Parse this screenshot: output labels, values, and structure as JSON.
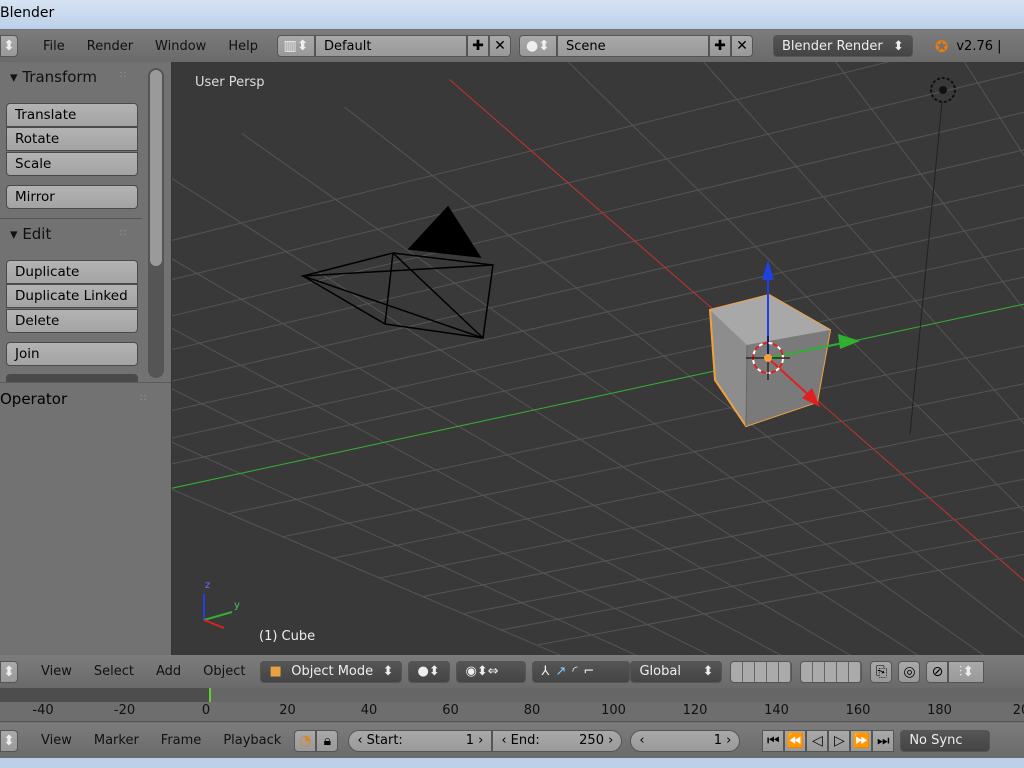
{
  "window": {
    "title": "Blender"
  },
  "topbar": {
    "menus": [
      "File",
      "Render",
      "Window",
      "Help"
    ],
    "screen_layout": "Default",
    "scene": "Scene",
    "render_engine": "Blender Render",
    "version": "v2.76 |"
  },
  "toolshelf": {
    "transform": {
      "title": "Transform",
      "buttons": [
        "Translate",
        "Rotate",
        "Scale",
        "Mirror"
      ]
    },
    "edit": {
      "title": "Edit",
      "buttons": [
        "Duplicate",
        "Duplicate Linked",
        "Delete",
        "Join"
      ]
    },
    "operator_title": "Operator"
  },
  "viewport": {
    "view_label": "User Persp",
    "object_label": "(1) Cube",
    "axis_labels": {
      "z": "z",
      "y": "y"
    }
  },
  "view3d_header": {
    "menus": [
      "View",
      "Select",
      "Add",
      "Object"
    ],
    "mode": "Object Mode",
    "orientation": "Global"
  },
  "timeline": {
    "ticks": [
      "-40",
      "-20",
      "0",
      "20",
      "40",
      "60",
      "80",
      "100",
      "120",
      "140",
      "160",
      "180",
      "20"
    ],
    "current_frame_marker": 0
  },
  "timeline_header": {
    "menus": [
      "View",
      "Marker",
      "Frame",
      "Playback"
    ],
    "start_label": "Start:",
    "start": "1",
    "end_label": "End:",
    "end": "250",
    "current": "1",
    "sync": "No Sync"
  },
  "colors": {
    "viewport_bg": "#393939",
    "selection": "#f0a040",
    "x_axis": "#c83030",
    "y_axis": "#30b030",
    "z_axis": "#2040e0"
  }
}
